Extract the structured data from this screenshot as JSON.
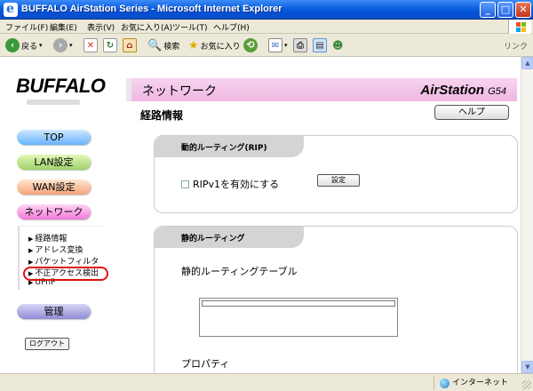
{
  "window": {
    "title": "BUFFALO AirStation Series - Microsoft Internet Explorer",
    "min_glyph": "_",
    "max_glyph": "□",
    "close_glyph": "✕"
  },
  "menubar": {
    "items": [
      "ファイル(F)",
      "編集(E)",
      "表示(V)",
      "お気に入り(A)",
      "ツール(T)",
      "ヘルプ(H)"
    ]
  },
  "toolbar": {
    "back_label": "戻る",
    "search_label": "検索",
    "favorites_label": "お気に入り",
    "links_label": "リンク"
  },
  "page": {
    "logo": "BUFFALO",
    "header_title": "ネットワーク",
    "brand": "AirStation",
    "brand_suffix": "G54",
    "page_title": "経路情報",
    "help_label": "ヘルプ"
  },
  "nav": {
    "top": "TOP",
    "lan": "LAN設定",
    "wan": "WAN設定",
    "network": "ネットワーク",
    "submenu": [
      "経路情報",
      "アドレス変換",
      "パケットフィルタ",
      "不正アクセス検出",
      "UPnP"
    ],
    "management": "管理",
    "logout": "ログアウト"
  },
  "rip_panel": {
    "title": "動的ルーティング(RIP)",
    "checkbox_label": "RIPv1を有効にする",
    "set_button": "設定"
  },
  "static_panel": {
    "title": "静的ルーティング",
    "table_label": "静的ルーティングテーブル",
    "property_label": "プロパティ"
  },
  "statusbar": {
    "zone": "インターネット"
  },
  "colors": {
    "accent_highlight": "#e01010",
    "header_pink": "#f0b7e2"
  }
}
